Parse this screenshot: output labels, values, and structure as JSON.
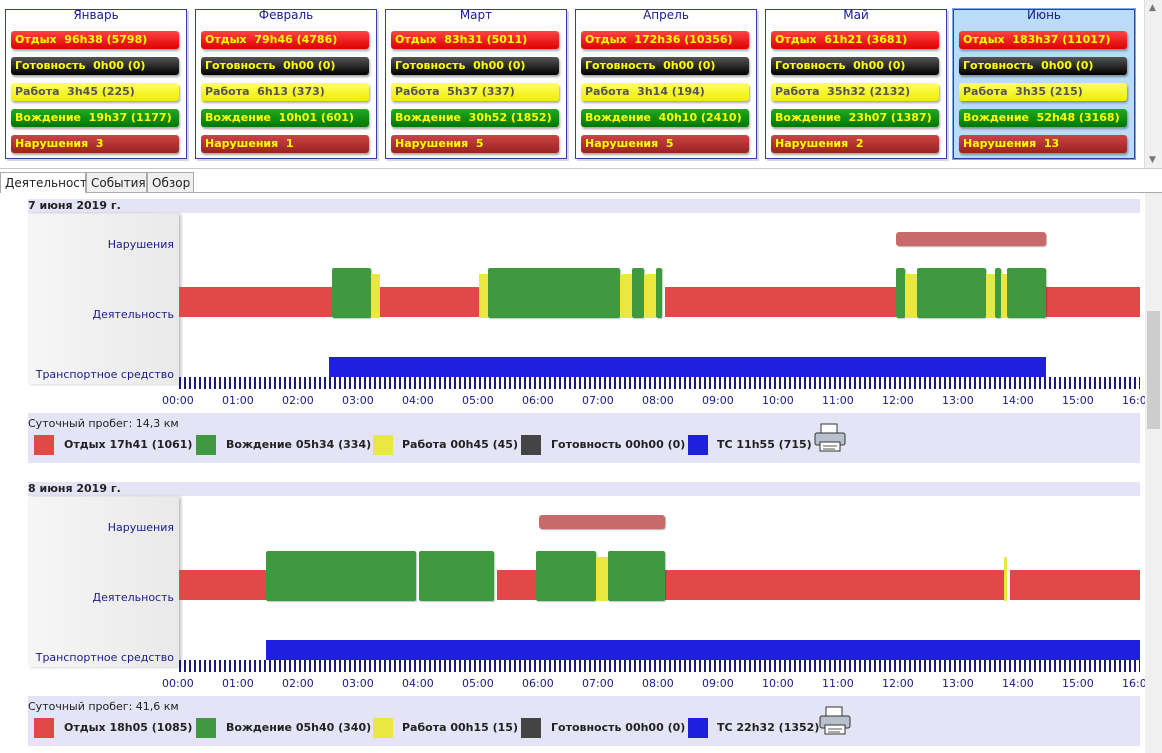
{
  "months": [
    {
      "name": "Январь",
      "rest": "Отдых  96h38 (5798)",
      "ready": "Готовность  0h00 (0)",
      "work": "Работа  3h45 (225)",
      "drive": "Вождение  19h37 (1177)",
      "viol": "Нарушения  3"
    },
    {
      "name": "Февраль",
      "rest": "Отдых  79h46 (4786)",
      "ready": "Готовность  0h00 (0)",
      "work": "Работа  6h13 (373)",
      "drive": "Вождение  10h01 (601)",
      "viol": "Нарушения  1"
    },
    {
      "name": "Март",
      "rest": "Отдых  83h31 (5011)",
      "ready": "Готовность  0h00 (0)",
      "work": "Работа  5h37 (337)",
      "drive": "Вождение  30h52 (1852)",
      "viol": "Нарушения  5"
    },
    {
      "name": "Апрель",
      "rest": "Отдых  172h36 (10356)",
      "ready": "Готовность  0h00 (0)",
      "work": "Работа  3h14 (194)",
      "drive": "Вождение  40h10 (2410)",
      "viol": "Нарушения  5"
    },
    {
      "name": "Май",
      "rest": "Отдых  61h21 (3681)",
      "ready": "Готовность  0h00 (0)",
      "work": "Работа  35h32 (2132)",
      "drive": "Вождение  23h07 (1387)",
      "viol": "Нарушения  2"
    },
    {
      "name": "Июнь",
      "rest": "Отдых  183h37 (11017)",
      "ready": "Готовность  0h00 (0)",
      "work": "Работа  3h35 (215)",
      "drive": "Вождение  52h48 (3168)",
      "viol": "Нарушения  13"
    }
  ],
  "tabs": [
    "Деятельность",
    "События",
    "Обзор"
  ],
  "row_labels": {
    "violations": "Нарушения",
    "activity": "Деятельность",
    "vehicle": "Транспортное средство"
  },
  "hours": [
    "00:00",
    "01:00",
    "02:00",
    "03:00",
    "04:00",
    "05:00",
    "06:00",
    "07:00",
    "08:00",
    "09:00",
    "10:00",
    "11:00",
    "12:00",
    "13:00",
    "14:00",
    "15:00",
    "16:0"
  ],
  "colors": {
    "rest": "#e34848",
    "drive": "#3f9a3f",
    "work": "#e8e840",
    "ready": "#444444",
    "vehicle": "#1f1fe0",
    "violation": "#c86a6a"
  },
  "days": [
    {
      "date": "7 июня 2019 г.",
      "mileage": "Суточный пробег: 14,3 км",
      "legend": {
        "rest": "Отдых 17h41 (1061)",
        "drive": "Вождение 05h34 (334)",
        "work": "Работа 00h45 (45)",
        "ready": "Готовность 00h00 (0)",
        "vehicle": "ТС 11h55 (715)"
      },
      "violations": [
        [
          11.95,
          14.45
        ]
      ],
      "rest": [
        [
          0,
          2.55
        ],
        [
          3.35,
          5.0
        ],
        [
          8.1,
          11.95
        ],
        [
          14.45,
          16.05
        ]
      ],
      "drive": [
        [
          2.55,
          3.2
        ],
        [
          5.15,
          7.35
        ],
        [
          7.55,
          7.75
        ],
        [
          7.95,
          8.05
        ],
        [
          11.95,
          12.1
        ],
        [
          12.3,
          13.45
        ],
        [
          13.6,
          13.7
        ],
        [
          13.8,
          14.45
        ]
      ],
      "work": [
        [
          3.2,
          3.35
        ],
        [
          5.0,
          5.15
        ],
        [
          7.35,
          7.55
        ],
        [
          7.75,
          7.95
        ],
        [
          12.1,
          12.3
        ],
        [
          13.45,
          13.6
        ],
        [
          13.7,
          13.8
        ]
      ],
      "vehicle": [
        [
          2.5,
          14.45
        ]
      ]
    },
    {
      "date": "8 июня 2019 г.",
      "mileage": "Суточный пробег: 41,6 км",
      "legend": {
        "rest": "Отдых 18h05 (1085)",
        "drive": "Вождение 05h40 (340)",
        "work": "Работа 00h15 (15)",
        "ready": "Готовность 00h00 (0)",
        "vehicle": "ТС 22h32 (1352)"
      },
      "violations": [
        [
          6.0,
          8.1
        ]
      ],
      "rest": [
        [
          0,
          1.45
        ],
        [
          5.3,
          5.95
        ],
        [
          8.1,
          13.75
        ],
        [
          13.85,
          16.05
        ]
      ],
      "drive": [
        [
          1.45,
          3.95
        ],
        [
          4.0,
          5.25
        ],
        [
          5.95,
          6.95
        ],
        [
          7.15,
          8.1
        ]
      ],
      "work": [
        [
          6.95,
          7.15
        ],
        [
          13.75,
          13.8
        ]
      ],
      "vehicle": [
        [
          1.45,
          16.05
        ]
      ]
    }
  ]
}
